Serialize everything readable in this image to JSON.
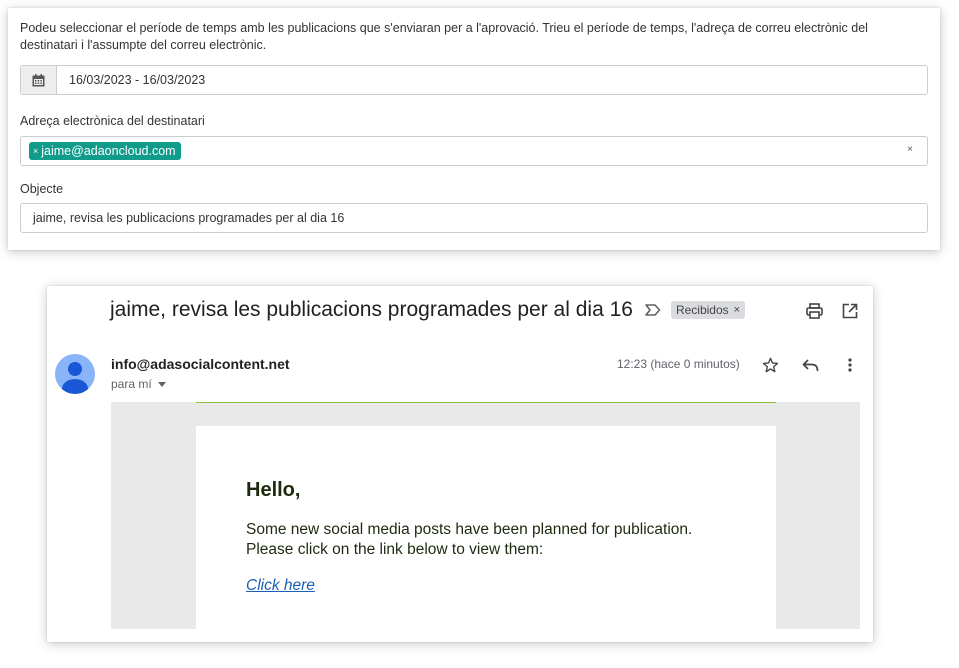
{
  "form": {
    "intro": "Podeu seleccionar el període de temps amb les publicacions que s'enviaran per a l'aprovació. Trieu el període de temps, l'adreça de correu electrònic del destinatari i l'assumpte del correu electrònic.",
    "date_range": "16/03/2023 - 16/03/2023",
    "recipient_label": "Adreça electrònica del destinatari",
    "recipient_tag": "jaime@adaoncloud.com",
    "tag_remove": "×",
    "clear": "×",
    "subject_label": "Objecte",
    "subject_value": "jaime, revisa les publicacions programades per al dia 16"
  },
  "email": {
    "subject": "jaime, revisa les publicacions programades per al dia 16",
    "label_chip": "Recibidos",
    "chip_remove": "×",
    "sender": "info@adasocialcontent.net",
    "to": "para mí",
    "time": "12:23 (hace 0 minutos)",
    "body": {
      "greeting": "Hello,",
      "line1": "Some new social media posts have been planned for publication.",
      "line2": "Please click on the link below to view them:",
      "link": "Click here"
    },
    "colors": {
      "tag": "#119b8a",
      "accent_line": "#8bbf3f",
      "link": "#1a5fb4",
      "avatar": "#8ab4f8"
    }
  }
}
